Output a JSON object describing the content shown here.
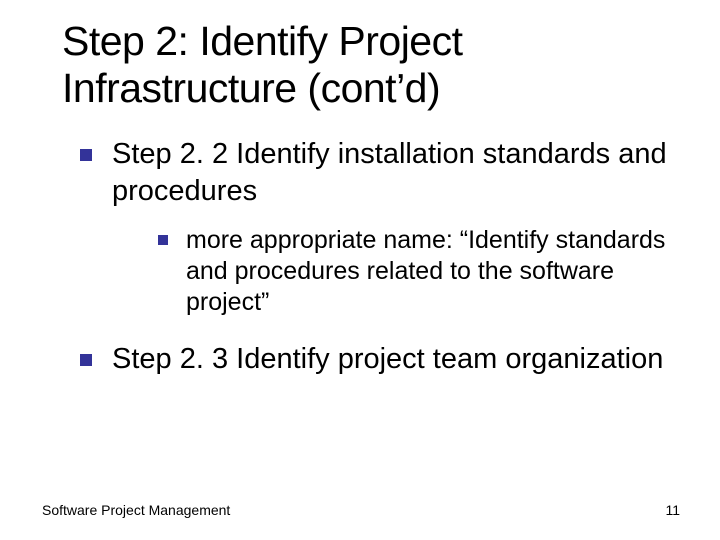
{
  "title": "Step 2: Identify Project Infrastructure (cont’d)",
  "bullets": {
    "b1": "Step 2. 2 Identify installation standards and procedures",
    "b1_sub": "more appropriate name: “Identify standards and procedures related to the software project”",
    "b2": "Step 2. 3 Identify project team organization"
  },
  "footer": {
    "left": "Software Project Management",
    "page": "11"
  }
}
